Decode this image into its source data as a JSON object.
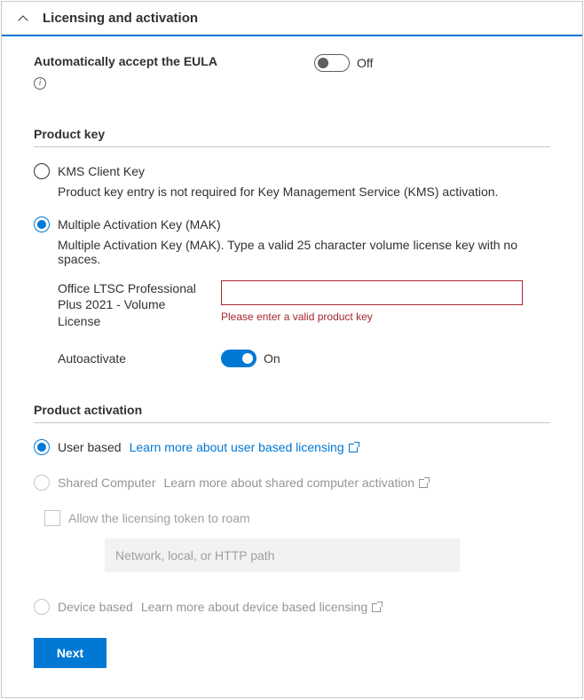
{
  "header": {
    "title": "Licensing and activation"
  },
  "eula": {
    "label": "Automatically accept the EULA",
    "toggle_state": "Off"
  },
  "product_key": {
    "section_title": "Product key",
    "kms": {
      "label": "KMS Client Key",
      "desc": "Product key entry is not required for Key Management Service (KMS) activation."
    },
    "mak": {
      "label": "Multiple Activation Key (MAK)",
      "desc": "Multiple Activation Key (MAK). Type a valid 25 character volume license key with no spaces.",
      "field_label": "Office LTSC Professional Plus 2021 - Volume License",
      "error": "Please enter a valid product key",
      "autoactivate_label": "Autoactivate",
      "autoactivate_state": "On"
    }
  },
  "activation": {
    "section_title": "Product activation",
    "user": {
      "label": "User based",
      "link": "Learn more about user based licensing"
    },
    "shared": {
      "label": "Shared Computer",
      "link": "Learn more about shared computer activation",
      "roam_label": "Allow the licensing token to roam",
      "roam_placeholder": "Network, local, or HTTP path"
    },
    "device": {
      "label": "Device based",
      "link": "Learn more about device based licensing"
    }
  },
  "footer": {
    "next": "Next"
  }
}
